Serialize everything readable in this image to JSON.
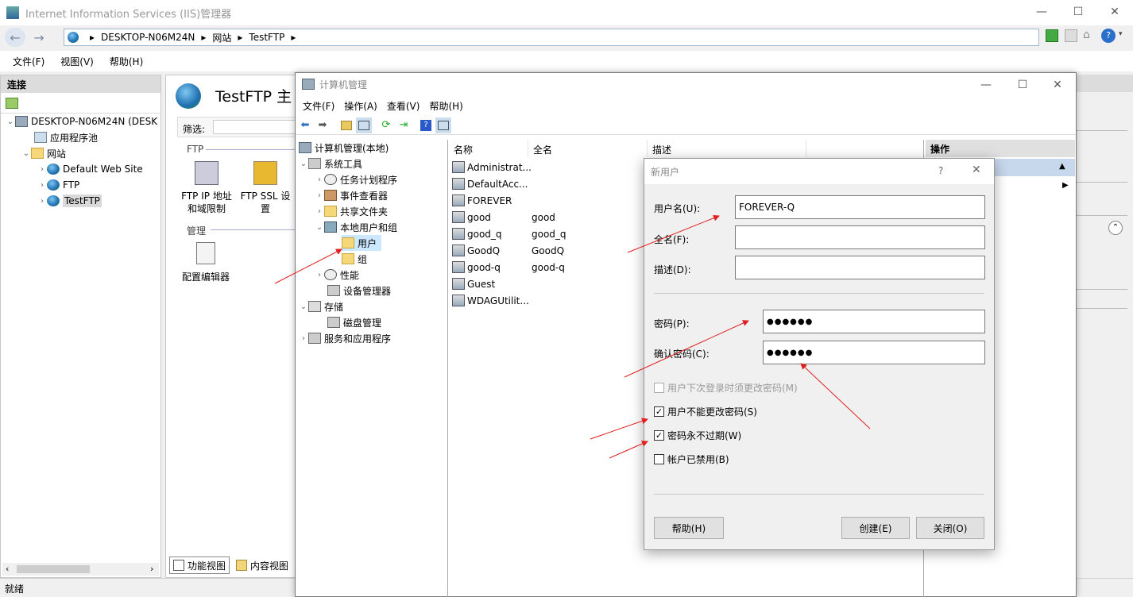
{
  "iis": {
    "title": "Internet Information Services (IIS)管理器",
    "breadcrumb": [
      "DESKTOP-N06M24N",
      "网站",
      "TestFTP"
    ],
    "menu": [
      "文件(F)",
      "视图(V)",
      "帮助(H)"
    ],
    "connections_label": "连接",
    "tree": [
      "DESKTOP-N06M24N (DESK",
      "应用程序池",
      "网站",
      "Default Web Site",
      "FTP",
      "TestFTP"
    ],
    "page_title": "TestFTP 主",
    "filter_label": "筛选:",
    "section_ftp": "FTP",
    "feature_ip": "FTP IP 地址\n和域限制",
    "feature_ip_1": "FTP IP 地址",
    "feature_ip_2": "和域限制",
    "feature_ssl_1": "FTP SSL 设",
    "feature_ssl_2": "置",
    "section_manage": "管理",
    "feature_config": "配置编辑器",
    "tab_features": "功能视图",
    "tab_content": "内容视图",
    "status": "就绪"
  },
  "cm": {
    "title": "计算机管理",
    "menu": [
      "文件(F)",
      "操作(A)",
      "查看(V)",
      "帮助(H)"
    ],
    "tree": [
      "计算机管理(本地)",
      "系统工具",
      "任务计划程序",
      "事件查看器",
      "共享文件夹",
      "本地用户和组",
      "用户",
      "组",
      "性能",
      "设备管理器",
      "存储",
      "磁盘管理",
      "服务和应用程序"
    ],
    "columns": [
      "名称",
      "全名",
      "描述"
    ],
    "users": [
      {
        "name": "Administrat...",
        "full": ""
      },
      {
        "name": "DefaultAcc...",
        "full": ""
      },
      {
        "name": "FOREVER",
        "full": ""
      },
      {
        "name": "good",
        "full": "good"
      },
      {
        "name": "good_q",
        "full": "good_q"
      },
      {
        "name": "GoodQ",
        "full": "GoodQ"
      },
      {
        "name": "good-q",
        "full": "good-q"
      },
      {
        "name": "Guest",
        "full": ""
      },
      {
        "name": "WDAGUtilit...",
        "full": ""
      }
    ],
    "actions_label": "操作"
  },
  "dialog": {
    "title": "新用户",
    "help_glyph": "?",
    "username_label": "用户名(U):",
    "username_value": "FOREVER-Q",
    "fullname_label": "全名(F):",
    "fullname_value": "",
    "desc_label": "描述(D):",
    "desc_value": "",
    "password_label": "密码(P):",
    "password_value": "●●●●●●",
    "confirm_label": "确认密码(C):",
    "confirm_value": "●●●●●●",
    "chk_must_change": "用户下次登录时须更改密码(M)",
    "chk_cannot_change": "用户不能更改密码(S)",
    "chk_never_expire": "密码永不过期(W)",
    "chk_disabled": "帐户已禁用(B)",
    "btn_help": "帮助(H)",
    "btn_create": "创建(E)",
    "btn_close": "关闭(O)",
    "checkbox_states": {
      "must_change": false,
      "cannot_change": true,
      "never_expire": true,
      "disabled": false
    }
  },
  "colors": {
    "accent": "#cde8ff",
    "arrow": "#e02020",
    "selected": "#cce8ff"
  }
}
